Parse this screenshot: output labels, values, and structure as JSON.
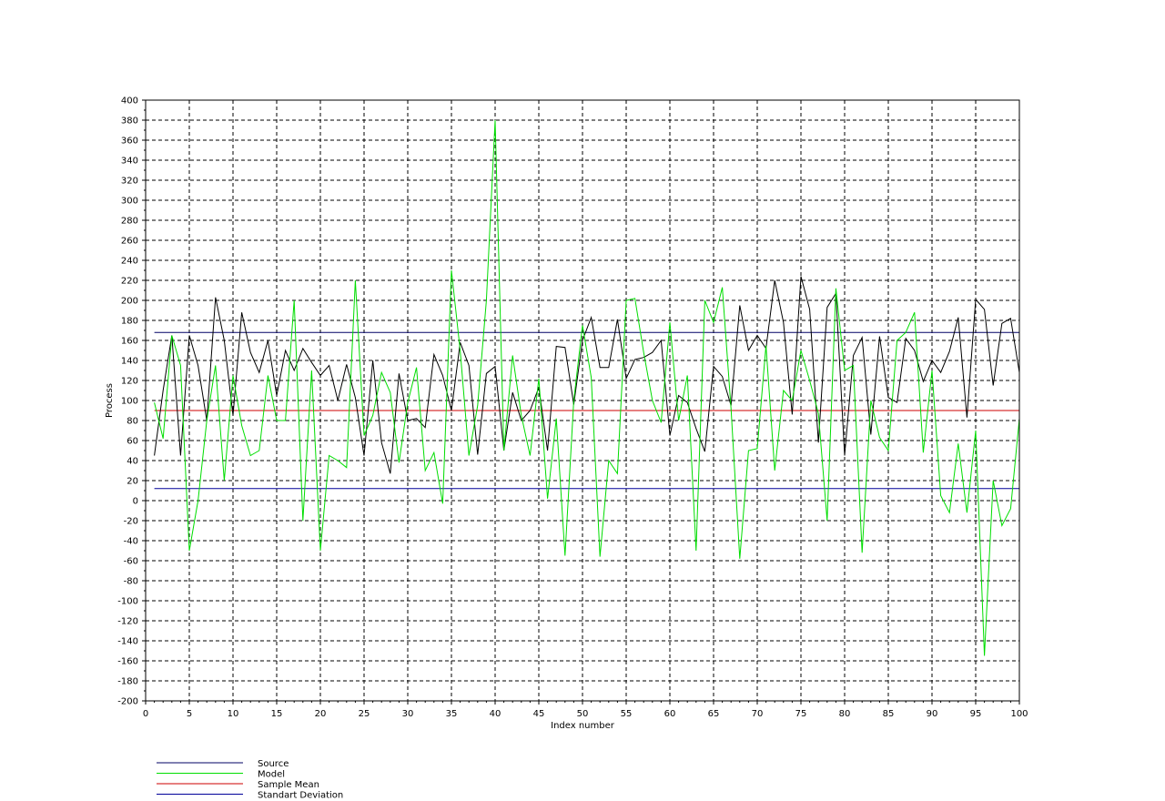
{
  "chart_data": {
    "type": "line",
    "title": "",
    "xlabel": "Index number",
    "ylabel": "Process",
    "xlim": [
      0,
      100
    ],
    "ylim": [
      -200,
      400
    ],
    "x_ticks": [
      0,
      5,
      10,
      15,
      20,
      25,
      30,
      35,
      40,
      45,
      50,
      55,
      60,
      65,
      70,
      75,
      80,
      85,
      90,
      95,
      100
    ],
    "y_ticks": [
      -200,
      -180,
      -160,
      -140,
      -120,
      -100,
      -80,
      -60,
      -40,
      -20,
      0,
      20,
      40,
      60,
      80,
      100,
      120,
      140,
      160,
      180,
      200,
      220,
      240,
      260,
      280,
      300,
      320,
      340,
      360,
      380,
      400
    ],
    "grid": true,
    "legend_position": "bottom-left",
    "x": [
      1,
      2,
      3,
      4,
      5,
      6,
      7,
      8,
      9,
      10,
      11,
      12,
      13,
      14,
      15,
      16,
      17,
      18,
      19,
      20,
      21,
      22,
      23,
      24,
      25,
      26,
      27,
      28,
      29,
      30,
      31,
      32,
      33,
      34,
      35,
      36,
      37,
      38,
      39,
      40,
      41,
      42,
      43,
      44,
      45,
      46,
      47,
      48,
      49,
      50,
      51,
      52,
      53,
      54,
      55,
      56,
      57,
      58,
      59,
      60,
      61,
      62,
      63,
      64,
      65,
      66,
      67,
      68,
      69,
      70,
      71,
      72,
      73,
      74,
      75,
      76,
      77,
      78,
      79,
      80,
      81,
      82,
      83,
      84,
      85,
      86,
      87,
      88,
      89,
      90,
      91,
      92,
      93,
      94,
      95,
      96,
      97,
      98,
      99,
      100
    ],
    "series": [
      {
        "name": "Source",
        "color": "#000000",
        "values": [
          45,
          110,
          165,
          45,
          165,
          135,
          80,
          203,
          160,
          85,
          188,
          148,
          128,
          160,
          105,
          150,
          130,
          152,
          138,
          125,
          135,
          100,
          136,
          103,
          45,
          140,
          58,
          27,
          127,
          80,
          82,
          73,
          146,
          125,
          90,
          158,
          135,
          46,
          127,
          134,
          50,
          108,
          80,
          90,
          113,
          50,
          154,
          153,
          96,
          160,
          183,
          133,
          133,
          181,
          122,
          141,
          143,
          148,
          160,
          65,
          105,
          98,
          72,
          49,
          134,
          124,
          95,
          195,
          150,
          165,
          152,
          220,
          178,
          86,
          224,
          191,
          58,
          193,
          207,
          45,
          145,
          163,
          66,
          164,
          103,
          98,
          162,
          150,
          119,
          140,
          128,
          149,
          183,
          83,
          201,
          191,
          115,
          177,
          182,
          128
        ]
      },
      {
        "name": "Model",
        "color": "#00dd00",
        "values": [
          98,
          62,
          165,
          135,
          -50,
          0,
          80,
          135,
          20,
          125,
          75,
          45,
          50,
          125,
          80,
          80,
          200,
          -20,
          130,
          -50,
          45,
          40,
          33,
          220,
          65,
          85,
          128,
          108,
          38,
          98,
          133,
          30,
          48,
          -3,
          230,
          150,
          45,
          95,
          200,
          380,
          50,
          145,
          85,
          45,
          122,
          2,
          82,
          -55,
          100,
          175,
          123,
          -56,
          40,
          27,
          200,
          202,
          148,
          100,
          78,
          178,
          80,
          125,
          -50,
          200,
          178,
          213,
          92,
          -58,
          50,
          52,
          155,
          30,
          110,
          100,
          150,
          120,
          87,
          -20,
          212,
          130,
          135,
          -52,
          100,
          63,
          50,
          160,
          168,
          188,
          48,
          130,
          5,
          -12,
          57,
          -12,
          70,
          -155,
          20,
          -25,
          -8,
          82
        ]
      },
      {
        "name": "Sample Mean",
        "color": "#cc0000",
        "values": [
          90,
          90
        ]
      },
      {
        "name": "Standart Deviation",
        "color": "#000099",
        "values": [
          12,
          12
        ]
      }
    ],
    "source_max_line": {
      "color": "#000066",
      "value": 168
    }
  }
}
